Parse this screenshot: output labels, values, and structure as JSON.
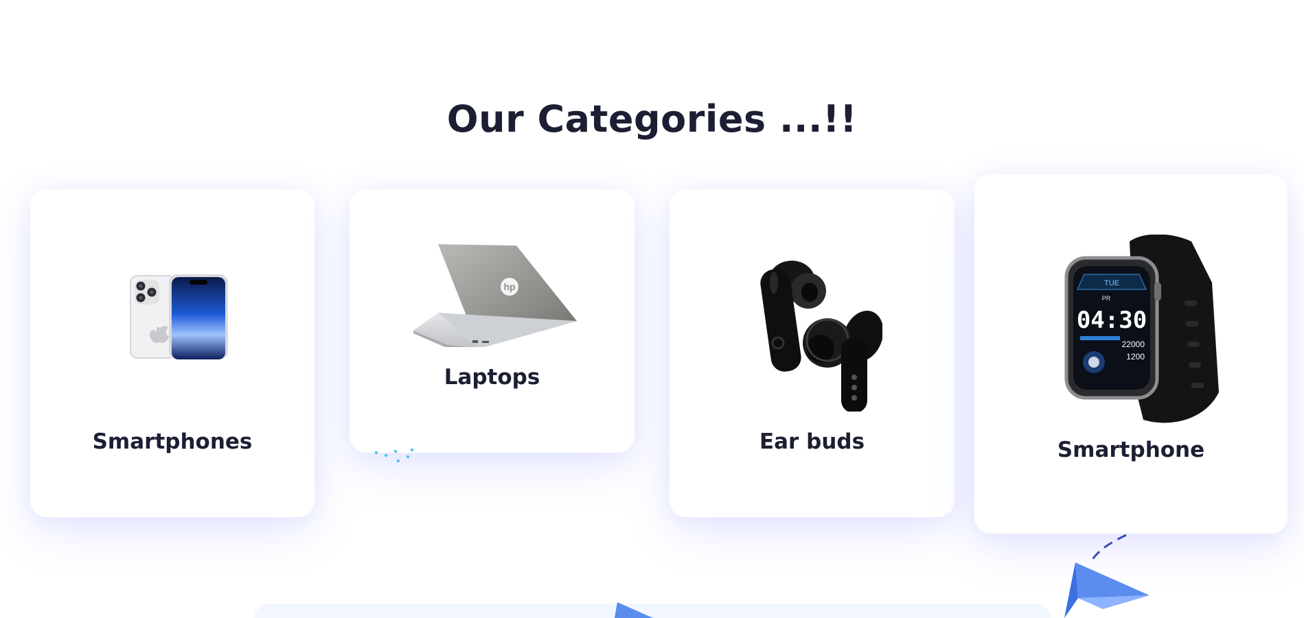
{
  "section": {
    "title": "Our Categories ...!!"
  },
  "categories": [
    {
      "label": "Smartphones",
      "icon": "smartphone-image"
    },
    {
      "label": "Laptops",
      "icon": "laptop-image"
    },
    {
      "label": "Ear buds",
      "icon": "earbuds-image"
    },
    {
      "label": "Smartphone",
      "icon": "smartwatch-image"
    }
  ],
  "watch_face": {
    "day": "TUE",
    "time": "04:30",
    "steps": "22000",
    "calories": "1200",
    "mode": "PR"
  },
  "colors": {
    "heading": "#1c1f33",
    "card_shadow": "#969fff",
    "accent_blue": "#5b8def",
    "dot_cyan": "#4cc3e8"
  }
}
